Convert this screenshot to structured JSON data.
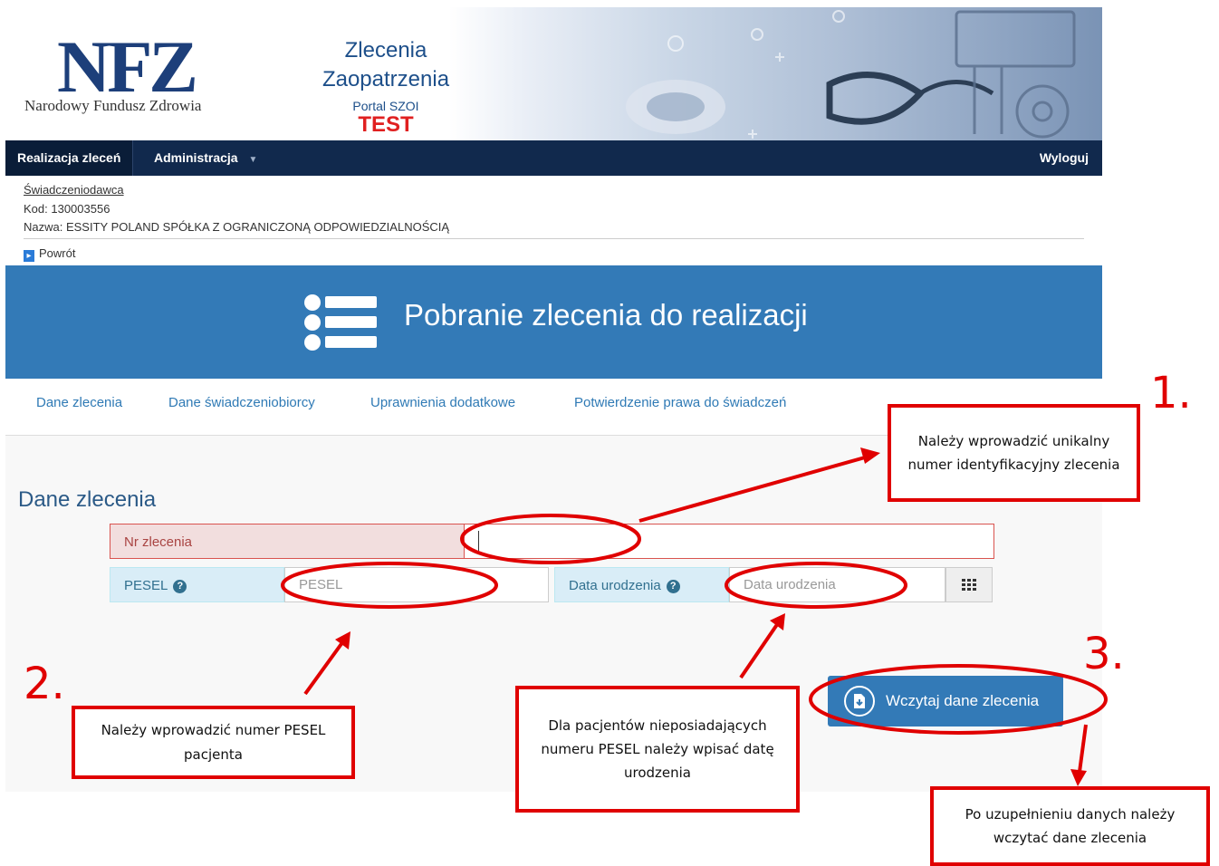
{
  "header": {
    "logo": "NFZ",
    "logo_subtitle": "Narodowy Fundusz Zdrowia",
    "app_title_1": "Zlecenia",
    "app_title_2": "Zaopatrzenia",
    "portal": "Portal SZOI",
    "env": "TEST"
  },
  "nav": {
    "items": [
      "Realizacja zleceń",
      "Administracja"
    ],
    "logout": "Wyloguj"
  },
  "provider": {
    "link": "Świadczeniodawca",
    "code": "Kod: 130003556",
    "name": "Nazwa: ESSITY POLAND SPÓŁKA Z OGRANICZONĄ ODPOWIEDZIALNOŚCIĄ",
    "back": "Powrót"
  },
  "banner": {
    "title": "Pobranie zlecenia do realizacji"
  },
  "tabs": [
    "Dane zlecenia",
    "Dane świadczeniobiorcy",
    "Uprawnienia dodatkowe",
    "Potwierdzenie prawa do świadczeń"
  ],
  "form": {
    "section_title": "Dane zlecenia",
    "nr_label": "Nr zlecenia",
    "nr_value": "",
    "pesel_label": "PESEL",
    "pesel_placeholder": "PESEL",
    "dob_label": "Data urodzenia",
    "dob_placeholder": "Data urodzenia",
    "load_button": "Wczytaj dane zlecenia"
  },
  "annotations": {
    "n1": "1.",
    "n2": "2.",
    "n3": "3.",
    "box1": "Należy wprowadzić unikalny numer identyfikacyjny zlecenia",
    "box2": "Należy wprowadzić numer PESEL pacjenta",
    "box3": "Dla pacjentów nieposiadających numeru PESEL należy wpisać datę urodzenia",
    "box4": "Po uzupełnieniu danych należy wczytać dane zlecenia"
  },
  "colors": {
    "nav": "#11294d",
    "banner": "#337ab7",
    "annotation": "#e00000"
  }
}
